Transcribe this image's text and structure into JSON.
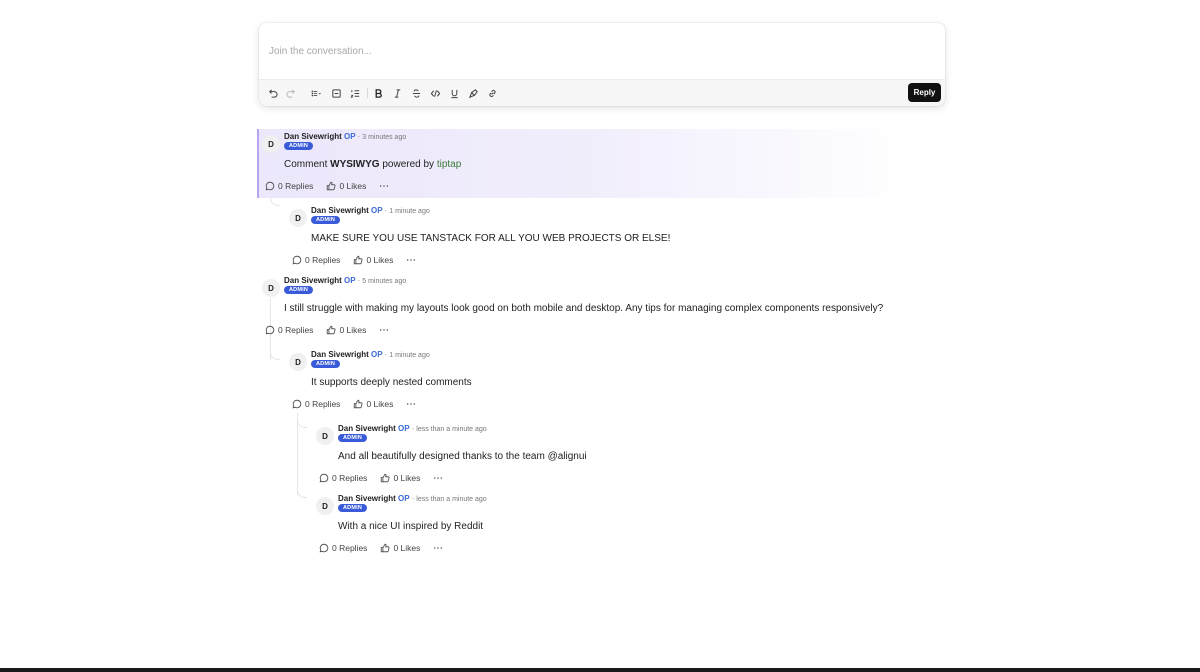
{
  "editor": {
    "placeholder": "Join the conversation...",
    "reply_label": "Reply",
    "toolbar_icons": [
      "undo-icon",
      "redo-icon",
      "bullet-list-icon",
      "task-list-icon",
      "ordered-list-icon",
      "bold-icon",
      "italic-icon",
      "strikethrough-icon",
      "code-icon",
      "underline-icon",
      "highlight-icon",
      "link-icon"
    ]
  },
  "comments": [
    {
      "avatar": "D",
      "author": "Dan Sivewright",
      "op": "OP",
      "sep": "·",
      "time": "3 minutes ago",
      "badge": "ADMIN",
      "body_pre": "Comment ",
      "body_bold": "WYSIWYG",
      "body_mid": " powered by ",
      "body_link": "tiptap",
      "replies": "0 Replies",
      "likes": "0 Likes"
    },
    {
      "avatar": "D",
      "author": "Dan Sivewright",
      "op": "OP",
      "sep": "·",
      "time": "1 minute ago",
      "badge": "ADMIN",
      "body": "MAKE SURE YOU USE TANSTACK FOR ALL YOU WEB PROJECTS OR ELSE!",
      "replies": "0 Replies",
      "likes": "0 Likes"
    },
    {
      "avatar": "D",
      "author": "Dan Sivewright",
      "op": "OP",
      "sep": "·",
      "time": "5 minutes ago",
      "badge": "ADMIN",
      "body": "I still struggle with making my layouts look good on both mobile and desktop. Any tips for managing complex components responsively?",
      "replies": "0 Replies",
      "likes": "0 Likes"
    },
    {
      "avatar": "D",
      "author": "Dan Sivewright",
      "op": "OP",
      "sep": "·",
      "time": "1 minute ago",
      "badge": "ADMIN",
      "body": "It supports deeply nested comments",
      "replies": "0 Replies",
      "likes": "0 Likes"
    },
    {
      "avatar": "D",
      "author": "Dan Sivewright",
      "op": "OP",
      "sep": "·",
      "time": "less than a minute ago",
      "badge": "ADMIN",
      "body": "And all beautifully designed thanks to the team @alignui",
      "replies": "0 Replies",
      "likes": "0 Likes"
    },
    {
      "avatar": "D",
      "author": "Dan Sivewright",
      "op": "OP",
      "sep": "·",
      "time": "less than a minute ago",
      "badge": "ADMIN",
      "body": "With a nice UI inspired by Reddit",
      "replies": "0 Replies",
      "likes": "0 Likes"
    }
  ],
  "colors": {
    "accent": "#3a5bd9",
    "op": "#3b6ad6",
    "highlight": "#ece7fb",
    "highlight_border": "#b8a3ee",
    "link": "#3b7a3b"
  }
}
